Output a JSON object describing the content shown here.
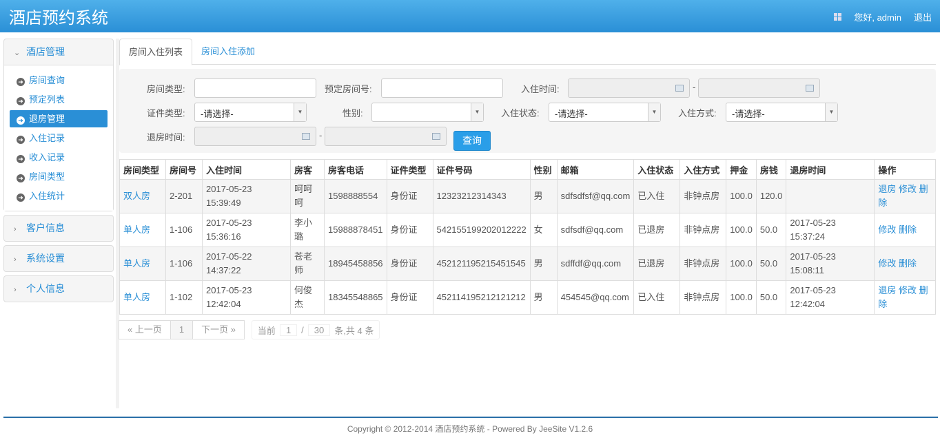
{
  "header": {
    "title": "酒店预约系统",
    "greeting": "您好, admin",
    "logout": "退出"
  },
  "sidebar": {
    "groups": [
      {
        "label": "酒店管理",
        "items": [
          "房间查询",
          "预定列表",
          "退房管理",
          "入住记录",
          "收入记录",
          "房间类型",
          "入住统计"
        ],
        "active": 2
      },
      {
        "label": "客户信息"
      },
      {
        "label": "系统设置"
      },
      {
        "label": "个人信息"
      }
    ]
  },
  "tabs": [
    "房间入住列表",
    "房间入住添加"
  ],
  "filter": {
    "room_type": "房间类型:",
    "reserved_room": "预定房间号:",
    "checkin_time": "入住时间:",
    "id_type": "证件类型:",
    "id_type_value": "-请选择-",
    "gender": "性别:",
    "checkin_status": "入住状态:",
    "checkin_status_value": "-请选择-",
    "checkin_mode": "入住方式:",
    "checkin_mode_value": "-请选择-",
    "checkout_time": "退房时间:",
    "dash": "-",
    "search": "查询"
  },
  "table": {
    "headers": [
      "房间类型",
      "房间号",
      "入住时间",
      "房客",
      "房客电话",
      "证件类型",
      "证件号码",
      "性别",
      "邮箱",
      "入住状态",
      "入住方式",
      "押金",
      "房钱",
      "退房时间",
      "操作"
    ],
    "rows": [
      [
        "双人房",
        "2-201",
        "2017-05-23 15:39:49",
        "呵呵呵",
        "1598888554",
        "身份证",
        "12323212314343",
        "男",
        "sdfsdfsf@qq.com",
        "已入住",
        "非钟点房",
        "100.0",
        "120.0",
        ""
      ],
      [
        "单人房",
        "1-106",
        "2017-05-23 15:36:16",
        "李小璐",
        "15988878451",
        "身份证",
        "542155199202012222",
        "女",
        "sdfsdf@qq.com",
        "已退房",
        "非钟点房",
        "100.0",
        "50.0",
        "2017-05-23 15:37:24"
      ],
      [
        "单人房",
        "1-106",
        "2017-05-22 14:37:22",
        "苍老师",
        "18945458856",
        "身份证",
        "452121195215451545",
        "男",
        "sdffdf@qq.com",
        "已退房",
        "非钟点房",
        "100.0",
        "50.0",
        "2017-05-23 15:08:11"
      ],
      [
        "单人房",
        "1-102",
        "2017-05-23 12:42:04",
        "何俊杰",
        "18345548865",
        "身份证",
        "452114195212121212",
        "男",
        "454545@qq.com",
        "已入住",
        "非钟点房",
        "100.0",
        "50.0",
        "2017-05-23 12:42:04"
      ]
    ],
    "actions": [
      [
        "退房",
        "修改",
        "删除"
      ],
      [
        "修改",
        "删除"
      ],
      [
        "修改",
        "删除"
      ],
      [
        "退房",
        "修改",
        "删除"
      ]
    ]
  },
  "pager": {
    "prev": "« 上一页",
    "page": "1",
    "next": "下一页 »",
    "current_label": "当前",
    "current": "1",
    "slash": "/",
    "size": "30",
    "total": "条,共 4 条"
  },
  "footer": "Copyright © 2012-2014 酒店预约系统 - Powered By JeeSite V1.2.6"
}
